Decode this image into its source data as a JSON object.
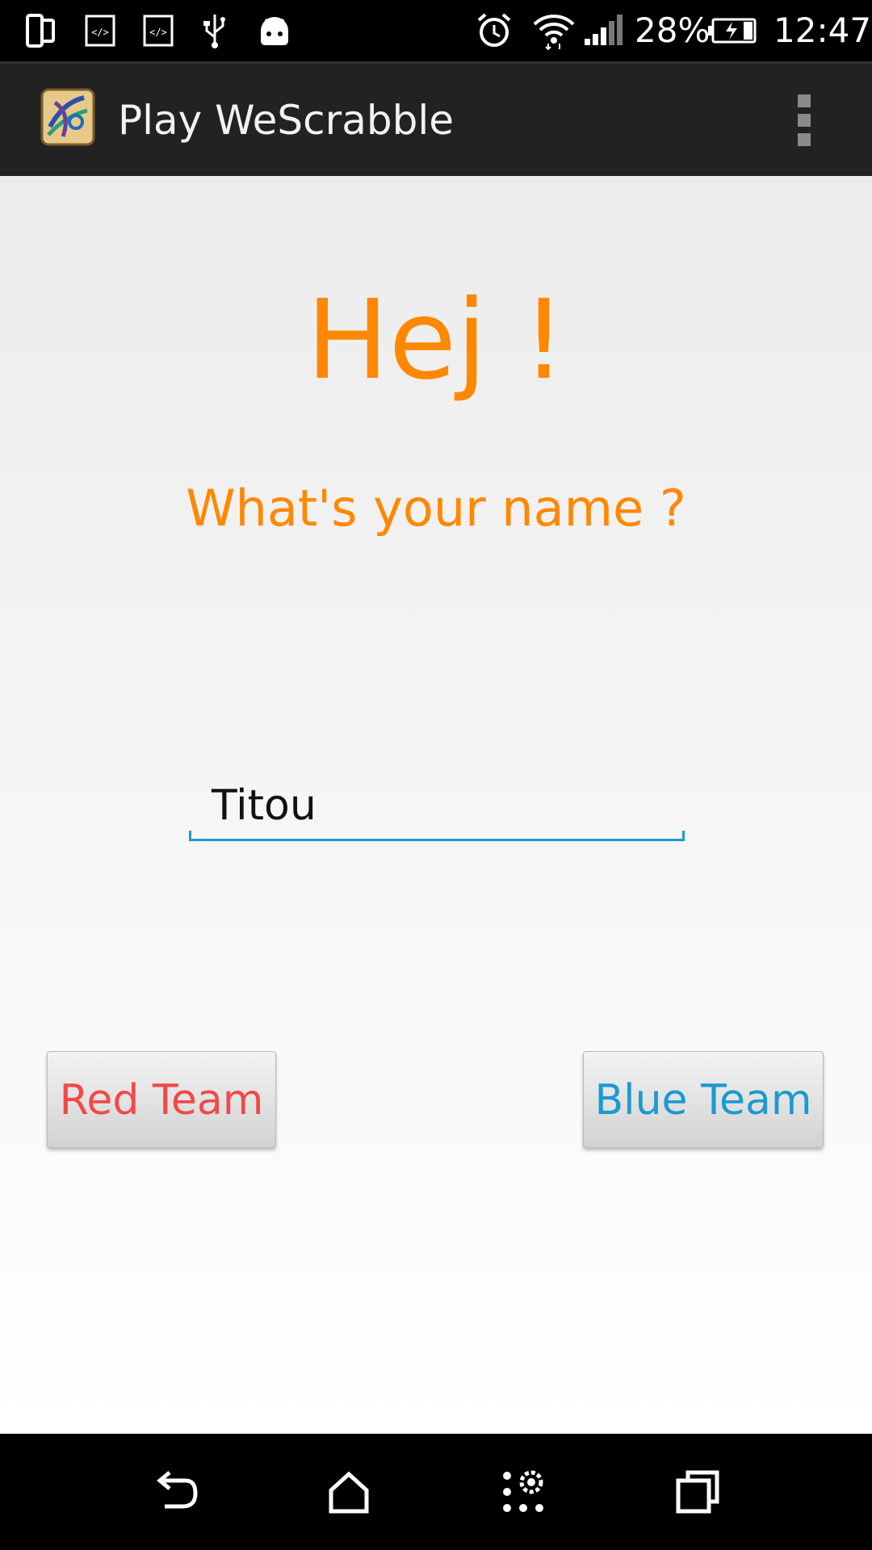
{
  "status_bar": {
    "battery_percent": "28%",
    "time": "12:47",
    "icons": [
      "phone-outline-icon",
      "code-icon",
      "code-icon",
      "usb-icon",
      "android-icon",
      "alarm-icon",
      "wifi-icon",
      "signal-icon",
      "battery-charging-icon"
    ]
  },
  "action_bar": {
    "title": "Play WeScrabble",
    "overflow_icon": "overflow-menu-icon"
  },
  "main": {
    "greeting": "Hej !",
    "question": "What's your name ?",
    "name_input": {
      "value": "Titou"
    },
    "buttons": {
      "red": "Red Team",
      "blue": "Blue Team"
    }
  },
  "nav_bar": {
    "icons": [
      "back-icon",
      "home-icon",
      "apps-settings-icon",
      "recents-icon"
    ]
  },
  "colors": {
    "accent_orange": "#ff8800",
    "red_team": "#f14949",
    "blue_team": "#1a9bcf"
  }
}
